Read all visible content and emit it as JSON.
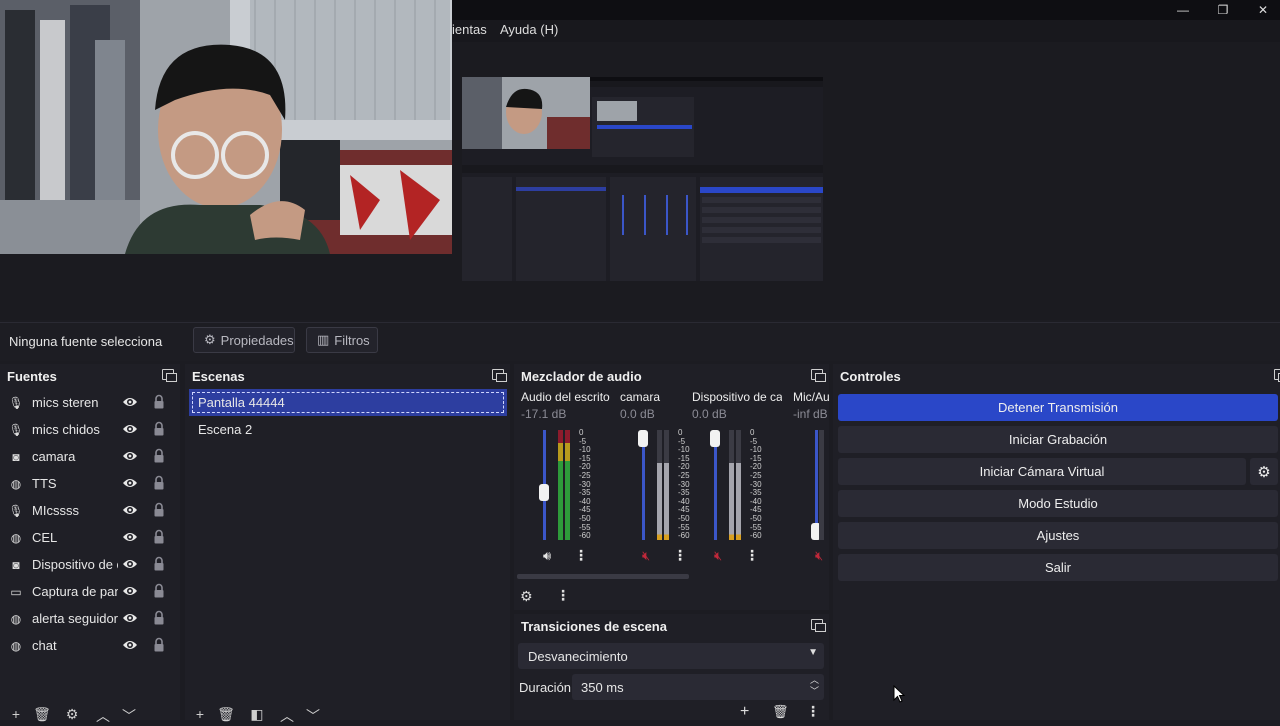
{
  "window": {
    "minimize_glyph": "—",
    "maximize_glyph": "❐",
    "close_glyph": "✕"
  },
  "menu": {
    "items": [
      "ientas",
      "Ayuda (H)"
    ]
  },
  "source_toolbar": {
    "status": "Ninguna fuente selecciona",
    "properties_label": "Propiedades",
    "filters_label": "Filtros"
  },
  "sources": {
    "title": "Fuentes",
    "items": [
      {
        "label": "mics steren",
        "icon": "microphone-icon"
      },
      {
        "label": "mics chidos",
        "icon": "microphone-icon"
      },
      {
        "label": "camara",
        "icon": "camera-icon"
      },
      {
        "label": "TTS",
        "icon": "globe-icon"
      },
      {
        "label": "MIcssss",
        "icon": "microphone-icon"
      },
      {
        "label": "CEL",
        "icon": "globe-icon"
      },
      {
        "label": "Dispositivo de c",
        "icon": "camera-icon"
      },
      {
        "label": "Captura de pant",
        "icon": "monitor-icon"
      },
      {
        "label": "alerta seguidor",
        "icon": "globe-icon"
      },
      {
        "label": "chat",
        "icon": "globe-icon"
      }
    ]
  },
  "scenes": {
    "title": "Escenas",
    "items": [
      "Pantalla 44444",
      "Escena 2"
    ],
    "selected": "Pantalla 44444"
  },
  "mixer": {
    "title": "Mezclador de audio",
    "scale": [
      "0",
      "-5",
      "-10",
      "-15",
      "-20",
      "-25",
      "-30",
      "-35",
      "-40",
      "-45",
      "-50",
      "-55",
      "-60"
    ],
    "channels": [
      {
        "name": "Audio del escrito",
        "db": "-17.1 dB",
        "muted": false,
        "level": 0.42
      },
      {
        "name": "camara",
        "db": "0.0 dB",
        "muted": true,
        "level": 1.0
      },
      {
        "name": "Dispositivo de ca",
        "db": "0.0 dB",
        "muted": true,
        "level": 1.0
      },
      {
        "name": "Mic/Au",
        "db": "-inf dB",
        "muted": true,
        "level": 0.0
      }
    ]
  },
  "transitions": {
    "title": "Transiciones de escena",
    "selected": "Desvanecimiento",
    "duration_label": "Duración",
    "duration_value": "350 ms"
  },
  "controls": {
    "title": "Controles",
    "buttons": [
      "Detener Transmisión",
      "Iniciar Grabación",
      "Iniciar Cámara Virtual",
      "Modo Estudio",
      "Ajustes",
      "Salir"
    ]
  },
  "colors": {
    "accent": "#2a47c8",
    "selection": "#2d3ea0",
    "mute_red": "#c0283a"
  }
}
